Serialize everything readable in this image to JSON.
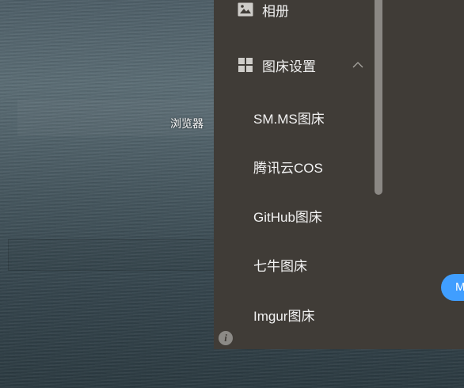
{
  "background": {
    "floating_label": "浏览器"
  },
  "sidebar": {
    "album": {
      "label": "相册",
      "icon": "image-icon"
    },
    "picbed_settings": {
      "label": "图床设置",
      "icon": "grid-icon",
      "expanded": true
    },
    "sub_items": [
      {
        "label": "SM.MS图床"
      },
      {
        "label": "腾讯云COS"
      },
      {
        "label": "GitHub图床"
      },
      {
        "label": "七牛图床"
      },
      {
        "label": "Imgur图床"
      }
    ]
  },
  "floating_button": {
    "label": "M",
    "color": "#409eff"
  },
  "colors": {
    "panel_bg": "#403c37",
    "text": "#f2f2f2",
    "accent": "#409eff"
  }
}
